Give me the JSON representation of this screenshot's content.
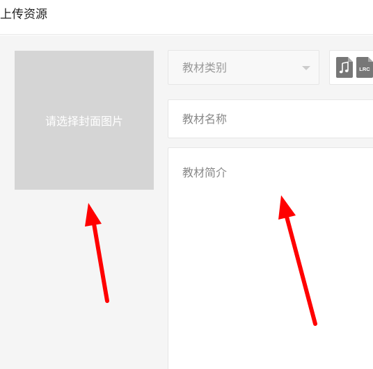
{
  "header": {
    "title": "上传资源"
  },
  "cover": {
    "label": "请选择封面图片"
  },
  "form": {
    "category_placeholder": "教材类别",
    "name_placeholder": "教材名称",
    "intro_placeholder": "教材简介"
  },
  "file_types": {
    "music_icon": "music-note-icon",
    "lrc_label": "LRC"
  },
  "colors": {
    "annotation_arrow": "#ff0000",
    "cover_bg": "#d5d5d5",
    "page_bg": "#f5f5f5"
  }
}
